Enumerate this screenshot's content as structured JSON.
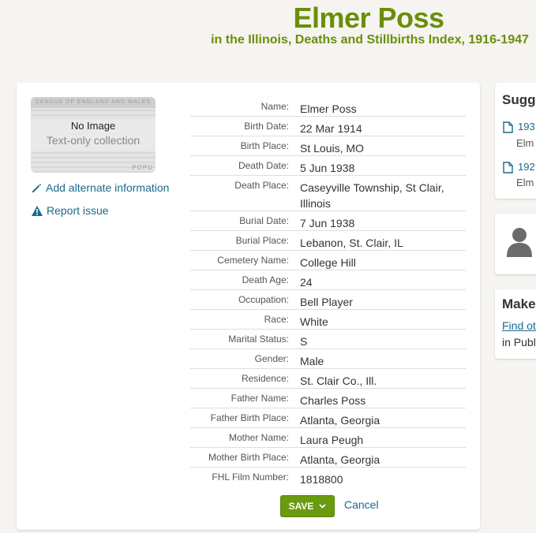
{
  "header": {
    "title": "Elmer Poss",
    "subtitle": "in the Illinois, Deaths and Stillbirths Index, 1916-1947"
  },
  "thumbnail": {
    "band_text": "CENSUS OF ENGLAND AND WALES",
    "no_image": "No Image",
    "text_only": "Text-only collection",
    "corner_text": "POPU"
  },
  "actions": {
    "add_alternate": "Add alternate information",
    "report_issue": "Report issue",
    "save": "SAVE",
    "cancel": "Cancel"
  },
  "record": {
    "fields": [
      {
        "label": "Name:",
        "value": "Elmer Poss"
      },
      {
        "label": "Birth Date:",
        "value": "22 Mar 1914"
      },
      {
        "label": "Birth Place:",
        "value": "St Louis, MO"
      },
      {
        "label": "Death Date:",
        "value": "5 Jun 1938"
      },
      {
        "label": "Death Place:",
        "value": "Caseyville Township, St Clair, Illinois"
      },
      {
        "label": "Burial Date:",
        "value": "7 Jun 1938"
      },
      {
        "label": "Burial Place:",
        "value": "Lebanon, St. Clair, IL"
      },
      {
        "label": "Cemetery Name:",
        "value": "College Hill"
      },
      {
        "label": "Death Age:",
        "value": "24"
      },
      {
        "label": "Occupation:",
        "value": "Bell Player"
      },
      {
        "label": "Race:",
        "value": "White"
      },
      {
        "label": "Marital Status:",
        "value": "S"
      },
      {
        "label": "Gender:",
        "value": "Male"
      },
      {
        "label": "Residence:",
        "value": "St. Clair Co., Ill."
      },
      {
        "label": "Father Name:",
        "value": "Charles Poss"
      },
      {
        "label": "Father Birth Place:",
        "value": "Atlanta, Georgia"
      },
      {
        "label": "Mother Name:",
        "value": "Laura Peugh"
      },
      {
        "label": "Mother Birth Place:",
        "value": "Atlanta, Georgia"
      },
      {
        "label": "FHL Film Number:",
        "value": "1818800"
      }
    ]
  },
  "suggested": {
    "title": "Sugge",
    "items": [
      {
        "year": "193",
        "name": "Elm"
      },
      {
        "year": "192",
        "name": "Elm"
      }
    ]
  },
  "make": {
    "title": "Make",
    "link": "Find ot",
    "text": "in Publ"
  },
  "colors": {
    "brand_green": "#6b8e0a",
    "save_green": "#6a9a10",
    "link_blue": "#1a6a8c"
  }
}
